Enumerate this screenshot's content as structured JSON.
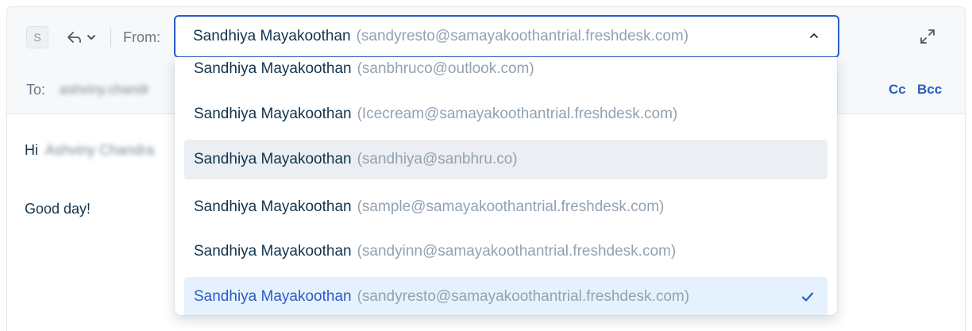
{
  "composer": {
    "avatar_initial": "S",
    "from_label": "From:",
    "from_selected": {
      "name": "Sandhiya Mayakoothan",
      "email": "(sandyresto@samayakoothantrial.freshdesk.com)"
    },
    "to_label": "To:",
    "to_value": "ashviny.chandr",
    "cc_label": "Cc",
    "bcc_label": "Bcc",
    "greeting_prefix": "Hi",
    "greeting_name": "Ashviny Chandra",
    "body_line": "Good day!"
  },
  "dropdown": {
    "options": [
      {
        "name": "Sandhiya Mayakoothan",
        "email": "(sanbhruco@outlook.com)",
        "state": "normal"
      },
      {
        "name": "Sandhiya Mayakoothan",
        "email": "(Icecream@samayakoothantrial.freshdesk.com)",
        "state": "normal"
      },
      {
        "name": "Sandhiya Mayakoothan",
        "email": "(sandhiya@sanbhru.co)",
        "state": "hover"
      },
      {
        "name": "Sandhiya Mayakoothan",
        "email": "(sample@samayakoothantrial.freshdesk.com)",
        "state": "normal"
      },
      {
        "name": "Sandhiya Mayakoothan",
        "email": "(sandyinn@samayakoothantrial.freshdesk.com)",
        "state": "normal"
      },
      {
        "name": "Sandhiya Mayakoothan",
        "email": "(sandyresto@samayakoothantrial.freshdesk.com)",
        "state": "selected"
      }
    ]
  },
  "colors": {
    "accent": "#2c5cc5",
    "text_primary": "#12344d",
    "text_muted": "#92a2b1",
    "hover_bg": "#ebeef2",
    "selected_bg": "#e5f2fd"
  },
  "icons": {
    "reply": "reply-arrow-icon",
    "reply_menu": "chevron-down-icon",
    "select_caret": "chevron-up-icon",
    "expand": "expand-arrows-icon",
    "selected_check": "check-icon"
  }
}
